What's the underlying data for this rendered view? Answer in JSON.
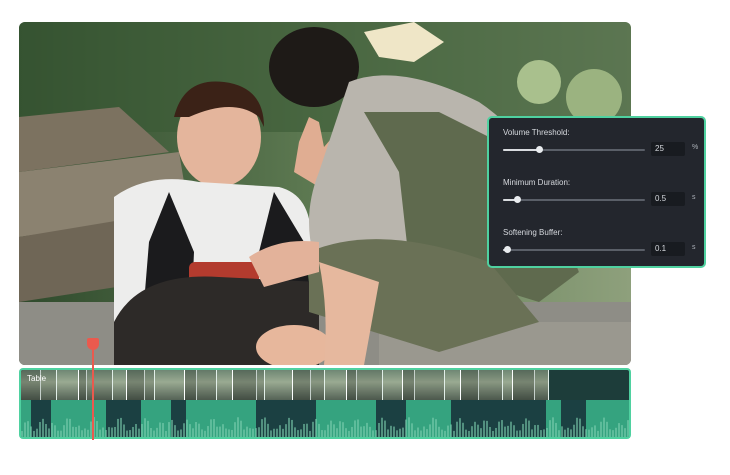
{
  "settings": {
    "volume_threshold": {
      "label": "Volume Threshold:",
      "value": "25",
      "unit": "%",
      "level": 0.25
    },
    "minimum_duration": {
      "label": "Minimum Duration:",
      "value": "0.5",
      "unit": "s",
      "level": 0.1
    },
    "softening_buffer": {
      "label": "Softening Buffer:",
      "value": "0.1",
      "unit": "s",
      "level": 0.03
    }
  },
  "timeline": {
    "clip_label": "Table"
  },
  "colors": {
    "accent": "#4fd1a0",
    "playhead": "#ea5a4e",
    "panel_bg": "#23262d"
  }
}
